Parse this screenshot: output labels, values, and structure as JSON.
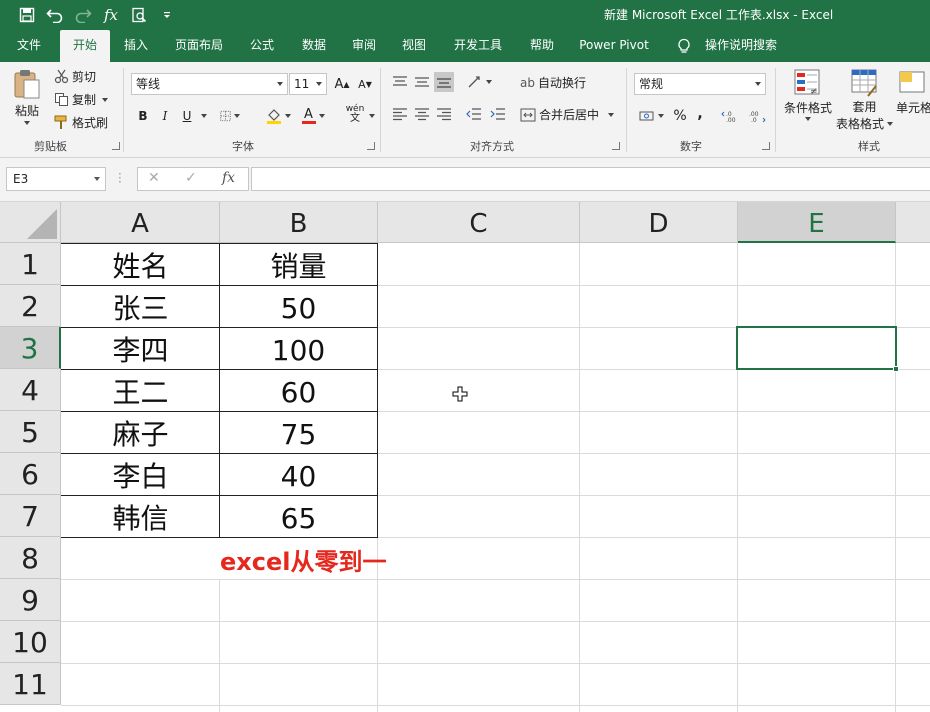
{
  "titlebar": {
    "document_title": "新建 Microsoft Excel 工作表.xlsx  -  Excel",
    "quick_access": [
      "save-icon",
      "undo-icon",
      "redo-icon",
      "function-icon",
      "print-preview-icon",
      "customize-qat-icon"
    ],
    "qat_fx_label": "fx"
  },
  "tabs": [
    {
      "label": "文件"
    },
    {
      "label": "开始",
      "active": true
    },
    {
      "label": "插入"
    },
    {
      "label": "页面布局"
    },
    {
      "label": "公式"
    },
    {
      "label": "数据"
    },
    {
      "label": "审阅"
    },
    {
      "label": "视图"
    },
    {
      "label": "开发工具"
    },
    {
      "label": "帮助"
    },
    {
      "label": "Power Pivot"
    },
    {
      "label": "操作说明搜索"
    }
  ],
  "ribbon": {
    "clipboard": {
      "group_label": "剪贴板",
      "paste_label": "粘贴",
      "cut_label": "剪切",
      "copy_label": "复制",
      "format_painter_label": "格式刷"
    },
    "font": {
      "group_label": "字体",
      "font_name": "等线",
      "font_size": "11",
      "grow_label": "A",
      "shrink_label": "A",
      "bold_label": "B",
      "italic_label": "I",
      "underline_label": "U",
      "phonetic_label": "wén",
      "font_color_label": "A"
    },
    "alignment": {
      "group_label": "对齐方式",
      "wrap_text_label": "自动换行",
      "wrap_icon_label": "ab",
      "merge_center_label": "合并后居中"
    },
    "number": {
      "group_label": "数字",
      "format_value": "常规",
      "percent_label": "%",
      "comma_label": ","
    },
    "styles": {
      "group_label": "样式",
      "conditional_format_label": "条件格式",
      "table_format_label_1": "套用",
      "table_format_label_2": "表格格式",
      "cell_styles_label": "单元格"
    }
  },
  "formula_bar": {
    "name_box": "E3",
    "cancel_label": "✕",
    "enter_label": "✓",
    "fx_label": "fx",
    "formula": ""
  },
  "sheet": {
    "columns": [
      "A",
      "B",
      "C",
      "D",
      "E"
    ],
    "rows": [
      "1",
      "2",
      "3",
      "4",
      "5",
      "6",
      "7",
      "8",
      "9",
      "10",
      "11"
    ],
    "selected_cell": "E3",
    "table": [
      [
        "姓名",
        "销量"
      ],
      [
        "张三",
        "50"
      ],
      [
        "李四",
        "100"
      ],
      [
        "王二",
        "60"
      ],
      [
        "麻子",
        "75"
      ],
      [
        "李白",
        "40"
      ],
      [
        "韩信",
        "65"
      ]
    ],
    "note": "excel从零到一",
    "note_color": "#e5281d",
    "accent_color": "#217346"
  }
}
